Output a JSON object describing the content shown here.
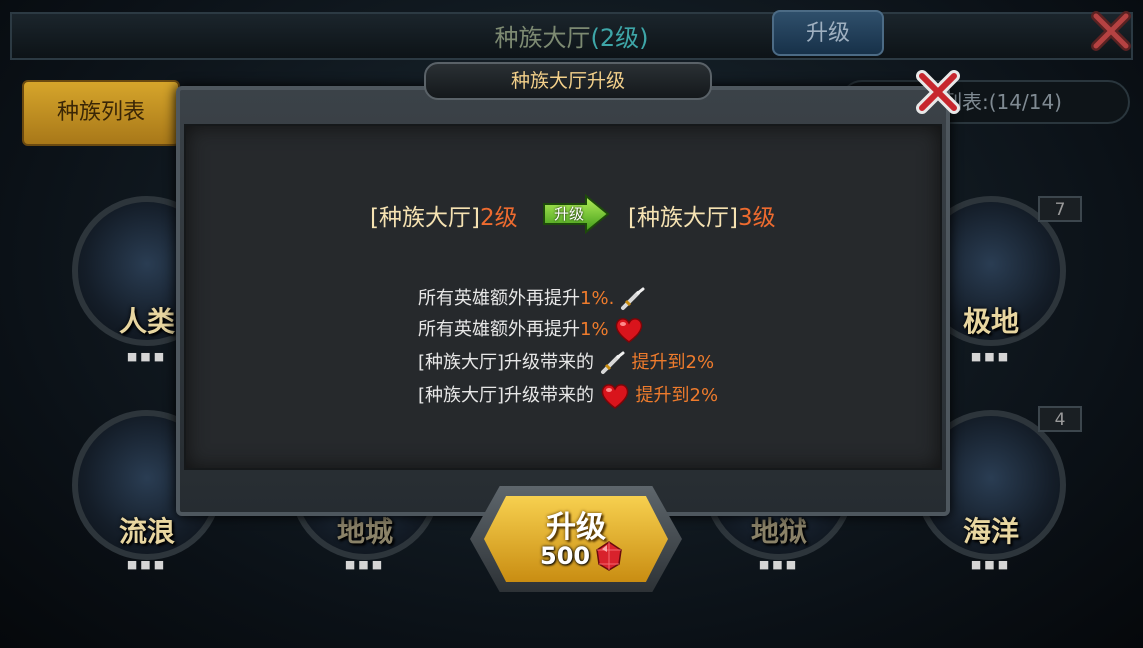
{
  "header": {
    "title": "种族大厅",
    "level": "(2级)",
    "upgrade_button": "升级"
  },
  "tabs": {
    "race_list": "种族列表"
  },
  "right_field": {
    "text": "列表:(14/14)"
  },
  "races": [
    {
      "name": "人类",
      "dots": "■■■"
    },
    {
      "name": "极地",
      "dots": "■■■",
      "badge": "7"
    },
    {
      "name": "流浪",
      "dots": "■■■"
    },
    {
      "name": "地城",
      "dots": "■■■"
    },
    {
      "name": "地狱",
      "dots": "■■■"
    },
    {
      "name": "海洋",
      "dots": "■■■",
      "badge": "4"
    }
  ],
  "dialog": {
    "title": "种族大厅升级",
    "from_name": "[种族大厅]",
    "from_level": "2级",
    "arrow_label": "升级",
    "to_name": "[种族大厅]",
    "to_level": "3级",
    "effects": [
      {
        "text": "所有英雄额外再提升",
        "value": "1%",
        "icon": "sword-icon",
        "suffix": ""
      },
      {
        "text": "所有英雄额外再提升",
        "value": "1%",
        "icon": "heart-icon",
        "suffix": ""
      },
      {
        "text": "[种族大厅]升级带来的",
        "value": "",
        "icon": "sword-icon",
        "suffix": "提升到2%"
      },
      {
        "text": "[种族大厅]升级带来的",
        "value": "",
        "icon": "heart-icon",
        "suffix": "提升到2%"
      }
    ],
    "confirm_label": "升级",
    "cost": "500"
  },
  "colors": {
    "accent_orange": "#ee6b2f",
    "gold": "#f7d04f",
    "panel": "#26292c"
  }
}
